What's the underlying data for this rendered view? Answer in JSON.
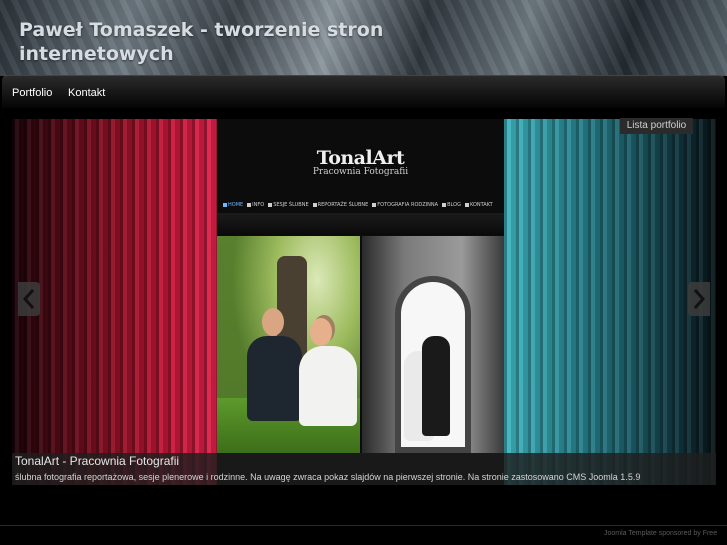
{
  "header": {
    "site_title": "Paweł Tomaszek - tworzenie stron internetowych"
  },
  "nav": {
    "items": [
      {
        "label": "Portfolio"
      },
      {
        "label": "Kontakt"
      }
    ]
  },
  "portfolio": {
    "list_button": "Lista portfolio",
    "preview": {
      "brand_title": "TonalArt",
      "brand_subtitle": "Pracownia Fotografii",
      "menu": [
        "HOME",
        "INFO",
        "SESJE ŚLUBNE",
        "REPORTAŻE ŚLUBNE",
        "FOTOGRAFIA RODZINNA",
        "BLOG",
        "KONTAKT"
      ]
    },
    "caption": {
      "title": "TonalArt - Pracownia Fotografii",
      "description": "ślubna fotografia reportażowa, sesje plenerowe i rodzinne. Na uwagę zwraca pokaz slajdów na pierwszej stronie. Na stronie zastosowano CMS Joomla 1.5.9"
    }
  },
  "footer": {
    "text": "Joomla Template sponsored by Free"
  },
  "icons": {
    "prev": "chevron-left-icon",
    "next": "chevron-right-icon"
  }
}
